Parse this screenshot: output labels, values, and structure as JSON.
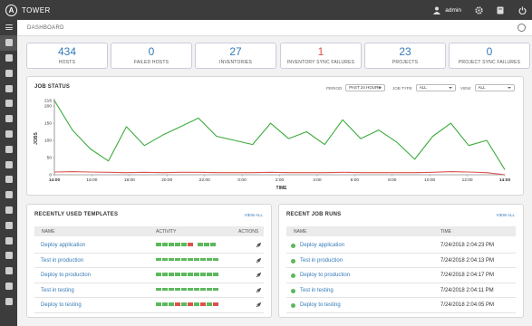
{
  "app": {
    "name": "TOWER",
    "logo_letter": "A"
  },
  "topbar": {
    "user": "admin",
    "icons": [
      "user-icon",
      "cog-icon",
      "docs-icon",
      "power-icon"
    ]
  },
  "sidebar": {
    "icons": [
      "menu-icon",
      "dashboard-icon",
      "jobs-icon",
      "schedules-icon",
      "portal-icon",
      "projects-icon",
      "credentials-icon",
      "inventories-icon",
      "hosts-icon",
      "templates-icon",
      "organizations-icon",
      "users-icon",
      "teams-icon",
      "inventory-scripts-icon",
      "notifications-icon",
      "management-jobs-icon",
      "instance-groups-icon",
      "applications-icon",
      "settings-icon"
    ]
  },
  "breadcrumb": {
    "label": "DASHBOARD"
  },
  "counts": [
    {
      "value": "434",
      "label": "HOSTS",
      "status": "ok"
    },
    {
      "value": "0",
      "label": "FAILED HOSTS",
      "status": "ok"
    },
    {
      "value": "27",
      "label": "INVENTORIES",
      "status": "ok"
    },
    {
      "value": "1",
      "label": "INVENTORY SYNC FAILURES",
      "status": "fail"
    },
    {
      "value": "23",
      "label": "PROJECTS",
      "status": "ok"
    },
    {
      "value": "0",
      "label": "PROJECT SYNC FAILURES",
      "status": "ok"
    }
  ],
  "job_status": {
    "title": "JOB STATUS",
    "period": {
      "label": "PERIOD",
      "value": "PAST 24 HOURS"
    },
    "job_type": {
      "label": "JOB TYPE",
      "value": "ALL"
    },
    "view": {
      "label": "VIEW",
      "value": "ALL"
    }
  },
  "chart_data": {
    "type": "line",
    "xlabel": "TIME",
    "ylabel": "JOBS",
    "ylim": [
      0,
      216
    ],
    "yticks": [
      "0",
      "50",
      "100",
      "150",
      "200",
      "216"
    ],
    "xticks": [
      "14:00",
      "16:00",
      "18:00",
      "20:00",
      "22:00",
      "0:00",
      "2:00",
      "4:00",
      "6:00",
      "8:00",
      "10:00",
      "12:00",
      "14:00"
    ],
    "x": [
      0,
      1,
      2,
      3,
      4,
      5,
      6,
      7,
      8,
      9,
      10,
      11,
      12,
      13,
      14,
      15,
      16,
      17,
      18,
      19,
      20,
      21,
      22,
      23,
      24
    ],
    "series": [
      {
        "values": [
          216,
          130,
          75,
          40,
          140,
          85,
          115,
          140,
          165,
          112,
          100,
          88,
          150,
          105,
          125,
          88,
          160,
          105,
          130,
          95,
          45,
          112,
          150,
          85,
          100,
          15
        ],
        "color": "#3cab3c"
      },
      {
        "values": [
          8,
          9,
          8,
          7,
          6,
          7,
          6,
          7,
          7,
          6,
          6,
          6,
          7,
          6,
          6,
          6,
          7,
          6,
          6,
          6,
          6,
          7,
          9,
          8,
          6,
          0
        ],
        "color": "#d9534f"
      }
    ]
  },
  "templates": {
    "title": "RECENTLY USED TEMPLATES",
    "view_all": "VIEW ALL",
    "headers": {
      "name": "NAME",
      "activity": "ACTIVITY",
      "actions": "ACTIONS"
    },
    "rows": [
      {
        "name": "Deploy application",
        "activity": [
          "s",
          "s",
          "s",
          "s",
          "s",
          "f",
          "g",
          "s",
          "s",
          "s"
        ]
      },
      {
        "name": "Test in production",
        "activity": [
          "s",
          "s",
          "s",
          "s",
          "s",
          "s",
          "s",
          "s",
          "s",
          "s"
        ]
      },
      {
        "name": "Deploy to production",
        "activity": [
          "s",
          "s",
          "s",
          "s",
          "s",
          "s",
          "s",
          "s",
          "s",
          "s"
        ]
      },
      {
        "name": "Test in testing",
        "activity": [
          "s",
          "s",
          "s",
          "s",
          "s",
          "s",
          "s",
          "s",
          "s",
          "s"
        ]
      },
      {
        "name": "Deploy to testing",
        "activity": [
          "s",
          "s",
          "s",
          "f",
          "s",
          "f",
          "s",
          "f",
          "s",
          "f"
        ]
      }
    ]
  },
  "jobs": {
    "title": "RECENT JOB RUNS",
    "view_all": "VIEW ALL",
    "headers": {
      "name": "NAME",
      "time": "TIME"
    },
    "rows": [
      {
        "name": "Deploy application",
        "time": "7/24/2018 2:04:23 PM"
      },
      {
        "name": "Test in production",
        "time": "7/24/2018 2:04:13 PM"
      },
      {
        "name": "Deploy to production",
        "time": "7/24/2018 2:04:17 PM"
      },
      {
        "name": "Test in testing",
        "time": "7/24/2018 2:04:11 PM"
      },
      {
        "name": "Deploy to testing",
        "time": "7/24/2018 2:04:05 PM"
      }
    ]
  },
  "colors": {
    "accent": "#337ab7",
    "success": "#5cb85c",
    "fail": "#d9534f",
    "chrome": "#3c3c3c"
  }
}
